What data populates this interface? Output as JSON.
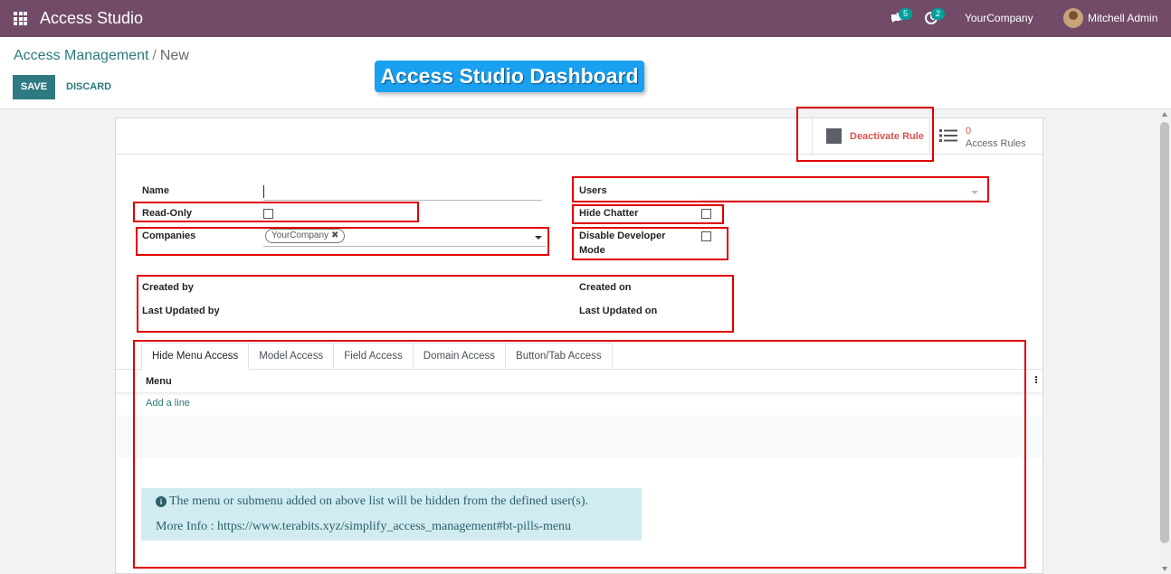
{
  "navbar": {
    "app_title": "Access Studio",
    "messages_badge": "5",
    "activities_badge": "2",
    "company": "YourCompany",
    "user": "Mitchell Admin"
  },
  "breadcrumb": {
    "parent": "Access Management",
    "separator": "/",
    "current": "New"
  },
  "actions": {
    "save": "SAVE",
    "discard": "DISCARD"
  },
  "banner": "Access Studio Dashboard",
  "button_box": {
    "deactivate": "Deactivate Rule",
    "access_rules_count": "0",
    "access_rules_label": "Access Rules"
  },
  "form": {
    "name_label": "Name",
    "name_value": "",
    "read_only_label": "Read-Only",
    "read_only_checked": false,
    "companies_label": "Companies",
    "companies_tags": [
      "YourCompany"
    ],
    "users_label": "Users",
    "hide_chatter_label": "Hide Chatter",
    "hide_chatter_checked": false,
    "disable_dev_label_line1": "Disable Developer",
    "disable_dev_label_line2": "Mode",
    "disable_dev_checked": false,
    "created_by_label": "Created by",
    "last_updated_by_label": "Last Updated by",
    "created_on_label": "Created on",
    "last_updated_on_label": "Last Updated on"
  },
  "tabs": [
    {
      "label": "Hide Menu Access",
      "active": true
    },
    {
      "label": "Model Access",
      "active": false
    },
    {
      "label": "Field Access",
      "active": false
    },
    {
      "label": "Domain Access",
      "active": false
    },
    {
      "label": "Button/Tab Access",
      "active": false
    }
  ],
  "list": {
    "column": "Menu",
    "add_line": "Add a line"
  },
  "info": {
    "line1": "The menu or submenu added on above list will be hidden from the defined user(s).",
    "line2": "More Info : https://www.terabits.xyz/simplify_access_management#bt-pills-menu"
  },
  "colors": {
    "navbar": "#714b67",
    "primary": "#2f7a82",
    "danger": "#d9534f",
    "highlight_box": "#e00000",
    "info_bg": "#d1ecf1",
    "banner": "#1aa0f0"
  }
}
